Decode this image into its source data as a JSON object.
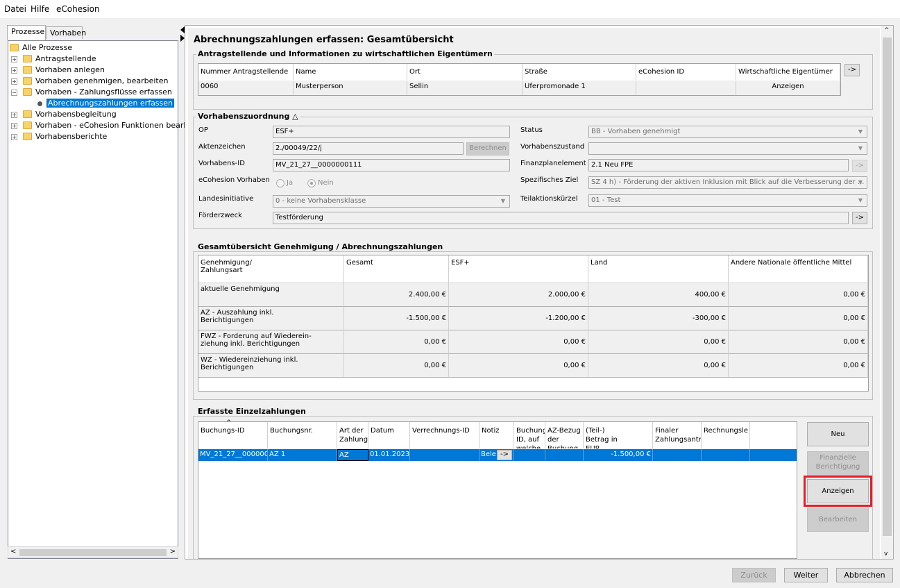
{
  "menu": {
    "file": "Datei",
    "help": "Hilfe",
    "ecohesion": "eCohesion"
  },
  "tabs": {
    "processes": "Prozesse",
    "projects": "Vorhaben"
  },
  "tree": {
    "root": "Alle Prozesse",
    "items": [
      "Antragstellende",
      "Vorhaben anlegen",
      "Vorhaben genehmigen, bearbeiten",
      "Vorhaben - Zahlungsflüsse erfassen",
      "Abrechnungszahlungen erfassen",
      "Vorhabensbegleitung",
      "Vorhaben - eCohesion Funktionen bearbeit",
      "Vorhabensberichte"
    ]
  },
  "page": {
    "title": "Abrechnungszahlungen erfassen: Gesamtübersicht"
  },
  "applicants": {
    "title": "Antragstellende und Informationen zu wirtschaftlichen Eigentümern",
    "columns": [
      "Nummer Antragstellende",
      "Name",
      "Ort",
      "Straße",
      "eCohesion ID",
      "Wirtschaftliche Eigentümer"
    ],
    "row": [
      "0060",
      "Musterperson",
      "Sellin",
      "Uferpromonade 1",
      "",
      "Anzeigen"
    ],
    "arrow": "->"
  },
  "assign": {
    "title": "Vorhabenszuordnung",
    "title_icon": "triangle-up-icon",
    "op_label": "OP",
    "op_value": "ESF+",
    "az_label": "Aktenzeichen",
    "az_value": "2./00049/22/j",
    "calc_btn": "Berechnen",
    "id_label": "Vorhabens-ID",
    "id_value": "MV_21_27__0000000111",
    "ecoh_label": "eCohesion Vorhaben",
    "yes": "Ja",
    "no": "Nein",
    "land_label": "Landesinitiative",
    "land_value": "0 - keine Vorhabensklasse",
    "zweck_label": "Förderzweck",
    "zweck_value": "Testförderung",
    "status_label": "Status",
    "status_value": "BB - Vorhaben genehmigt",
    "zustand_label": "Vorhabenszustand",
    "zustand_value": "",
    "fpe_label": "Finanzplanelement",
    "fpe_value": "2.1 Neu FPE",
    "ziel_label": "Spezifisches Ziel",
    "ziel_value": "SZ 4 h) - Förderung der aktiven Inklusion mit Blick auf die Verbesserung der ...",
    "tak_label": "Teilaktionskürzel",
    "tak_value": "01 - Test",
    "arrow": "->"
  },
  "overview": {
    "title": "Gesamtübersicht Genehmigung / Abrechnungszahlungen",
    "columns": [
      "Genehmigung/\nZahlungsart",
      "Gesamt",
      "ESF+",
      "Land",
      "Andere Nationale öffentliche Mittel"
    ],
    "rows": [
      {
        "label": "aktuelle Genehmigung",
        "vals": [
          "2.400,00 €",
          "2.000,00 €",
          "400,00 €",
          "0,00 €"
        ]
      },
      {
        "label": "AZ - Auszahlung inkl.\nBerichtigungen",
        "vals": [
          "-1.500,00 €",
          "-1.200,00 €",
          "-300,00 €",
          "0,00 €"
        ]
      },
      {
        "label": "FWZ - Forderung auf Wiederein-\nziehung inkl. Berichtigungen",
        "vals": [
          "0,00 €",
          "0,00 €",
          "0,00 €",
          "0,00 €"
        ]
      },
      {
        "label": "WZ - Wiedereinziehung inkl.\nBerichtigungen",
        "vals": [
          "0,00 €",
          "0,00 €",
          "0,00 €",
          "0,00 €"
        ]
      }
    ]
  },
  "payments": {
    "title": "Erfasste Einzelzahlungen",
    "columns": [
      "Buchungs-ID",
      "Buchungsnr.",
      "Art der\nZahlung",
      "Datum",
      "Verrechnungs-ID",
      "Notiz",
      "Buchungs-ID, auf\nwelche\ndie Bu",
      "AZ-Bezug der\nBuchung",
      "(Teil-)\nBetrag in\nEUR",
      "Finaler\nZahlungsantr",
      "Rechnungsle"
    ],
    "row": [
      "MV_21_27__000000",
      "AZ 1",
      "AZ",
      "01.01.2023",
      "",
      "Bele",
      "",
      "",
      "-1.500,00 €",
      "",
      ""
    ],
    "note_arrow": "->",
    "btn_new": "Neu",
    "btn_fin": "Finanzielle\nBerichtigung",
    "btn_show": "Anzeigen",
    "btn_edit": "Bearbeiten"
  },
  "footer": {
    "back": "Zurück",
    "next": "Weiter",
    "cancel": "Abbrechen"
  }
}
